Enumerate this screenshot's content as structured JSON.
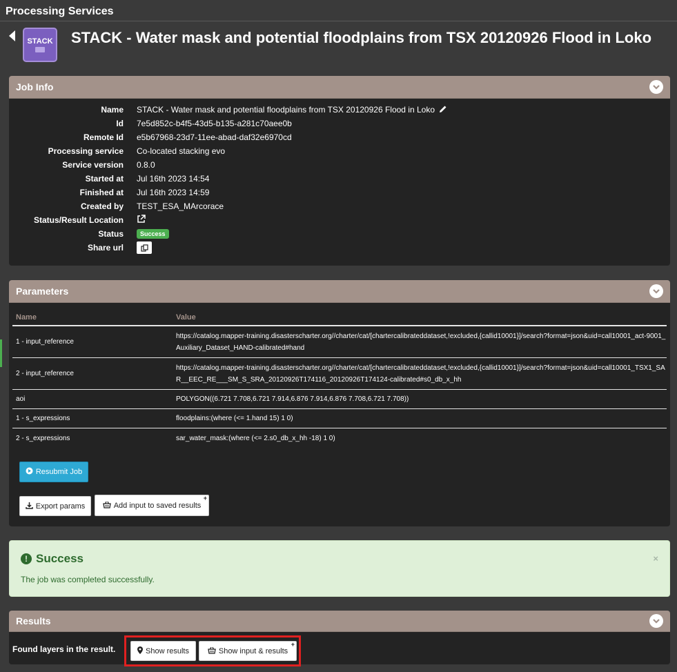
{
  "page": {
    "heading": "Processing Services",
    "job_title": "STACK - Water mask and potential floodplains from TSX 20120926 Flood in Loko",
    "service_icon_label": "STACK"
  },
  "job_info": {
    "title": "Job Info",
    "rows": [
      {
        "label": "Name",
        "value": "STACK - Water mask and potential floodplains from TSX 20120926 Flood in Loko"
      },
      {
        "label": "Id",
        "value": "7e5d852c-b4f5-43d5-b135-a281c70aee0b"
      },
      {
        "label": "Remote Id",
        "value": "e5b67968-23d7-11ee-abad-daf32e6970cd"
      },
      {
        "label": "Processing service",
        "value": "Co-located stacking evo"
      },
      {
        "label": "Service version",
        "value": "0.8.0"
      },
      {
        "label": "Started at",
        "value": "Jul 16th 2023 14:54"
      },
      {
        "label": "Finished at",
        "value": "Jul 16th 2023 14:59"
      },
      {
        "label": "Created by",
        "value": "TEST_ESA_MArcorace"
      },
      {
        "label": "Status/Result Location",
        "value": ""
      },
      {
        "label": "Status",
        "value": "Success"
      },
      {
        "label": "Share url",
        "value": ""
      }
    ]
  },
  "parameters": {
    "title": "Parameters",
    "col_name": "Name",
    "col_value": "Value",
    "rows": [
      {
        "name": "1 - input_reference",
        "value": "https://catalog.mapper-training.disasterscharter.org//charter/cat/[chartercalibrateddataset,!excluded,{callid10001}]/search?format=json&uid=call10001_act-9001_Auxiliary_Dataset_HAND-calibrated#hand"
      },
      {
        "name": "2 - input_reference",
        "value": "https://catalog.mapper-training.disasterscharter.org//charter/cat/[chartercalibrateddataset,!excluded,{callid10001}]/search?format=json&uid=call10001_TSX1_SAR__EEC_RE___SM_S_SRA_20120926T174116_20120926T174124-calibrated#s0_db_x_hh"
      },
      {
        "name": "aoi",
        "value": "POLYGON((6.721 7.708,6.721 7.914,6.876 7.914,6.876 7.708,6.721 7.708))"
      },
      {
        "name": "1 - s_expressions",
        "value": "floodplains:(where (<= 1.hand 15) 1 0)"
      },
      {
        "name": "2 - s_expressions",
        "value": "sar_water_mask:(where (<= 2.s0_db_x_hh -18) 1 0)"
      }
    ],
    "resubmit_label": "Resubmit Job",
    "export_label": "Export params",
    "add_saved_label": "Add input to saved results"
  },
  "alert": {
    "title": "Success",
    "message": "The job was completed successfully.",
    "close": "×"
  },
  "results": {
    "title": "Results",
    "found_label": "Found layers in the result.",
    "show_results_label": "Show results",
    "show_input_results_label": "Show input & results"
  },
  "colors": {
    "background": "#3a3a3a",
    "panel": "#232323",
    "panel_header": "#a3928a",
    "success_badge": "#4caf50",
    "primary_button": "#2ea9d4",
    "alert_bg": "#dff0d8",
    "highlight": "#e02020"
  }
}
